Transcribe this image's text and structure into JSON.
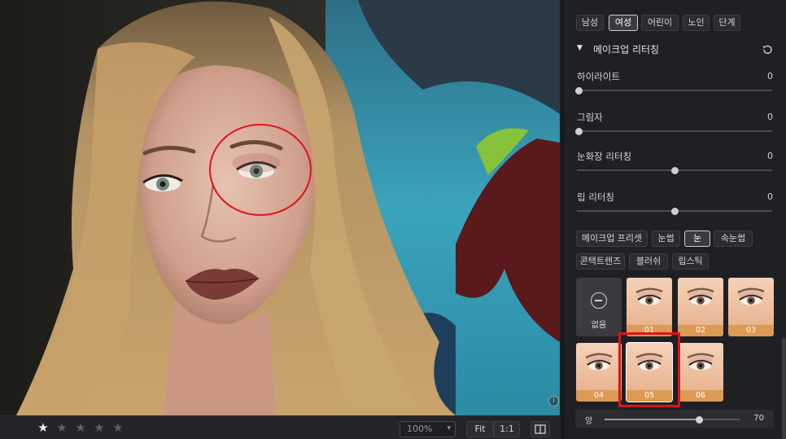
{
  "gender_tabs": [
    "남성",
    "여성",
    "어린이",
    "노인",
    "단계"
  ],
  "section": {
    "title": "메이크업 리터칭",
    "expanded": true
  },
  "sliders": [
    {
      "label": "하이라이트",
      "value": "0",
      "level": 0.0
    },
    {
      "label": "그림자",
      "value": "0",
      "level": 0.0
    },
    {
      "label": "눈화장 리터칭",
      "value": "0",
      "level": 0.5
    },
    {
      "label": "립 리터칭",
      "value": "0",
      "level": 0.5
    }
  ],
  "makeup_tabs_row1": [
    "메이크업 프리셋",
    "눈썹",
    "눈",
    "속눈썹"
  ],
  "makeup_tabs_row2": [
    "콘택트렌즈",
    "블러쉬",
    "립스틱"
  ],
  "active_makeup_tab": "눈",
  "active_gender_tab": "여성",
  "presets": [
    {
      "label": "없음",
      "type": "none"
    },
    {
      "label": "01"
    },
    {
      "label": "02"
    },
    {
      "label": "03"
    },
    {
      "label": "04"
    },
    {
      "label": "05",
      "selected": true
    },
    {
      "label": "06"
    }
  ],
  "amount": {
    "label": "양",
    "value": "70",
    "level": 0.7
  },
  "bottombar": {
    "rating": 1,
    "rating_max": 5,
    "zoom": "100%",
    "fit_label": "Fit",
    "one_to_one_label": "1:1"
  },
  "info_icon": "i",
  "colors": {
    "accent_orange": "#dc9a55",
    "annotation_red": "#e0121a",
    "panel_bg": "#1f2023"
  },
  "icons": {
    "reset": "reset-icon",
    "collapse": "triangle-down-icon",
    "compare": "compare-icon",
    "info": "info-icon",
    "none": "minus-circle-icon"
  }
}
